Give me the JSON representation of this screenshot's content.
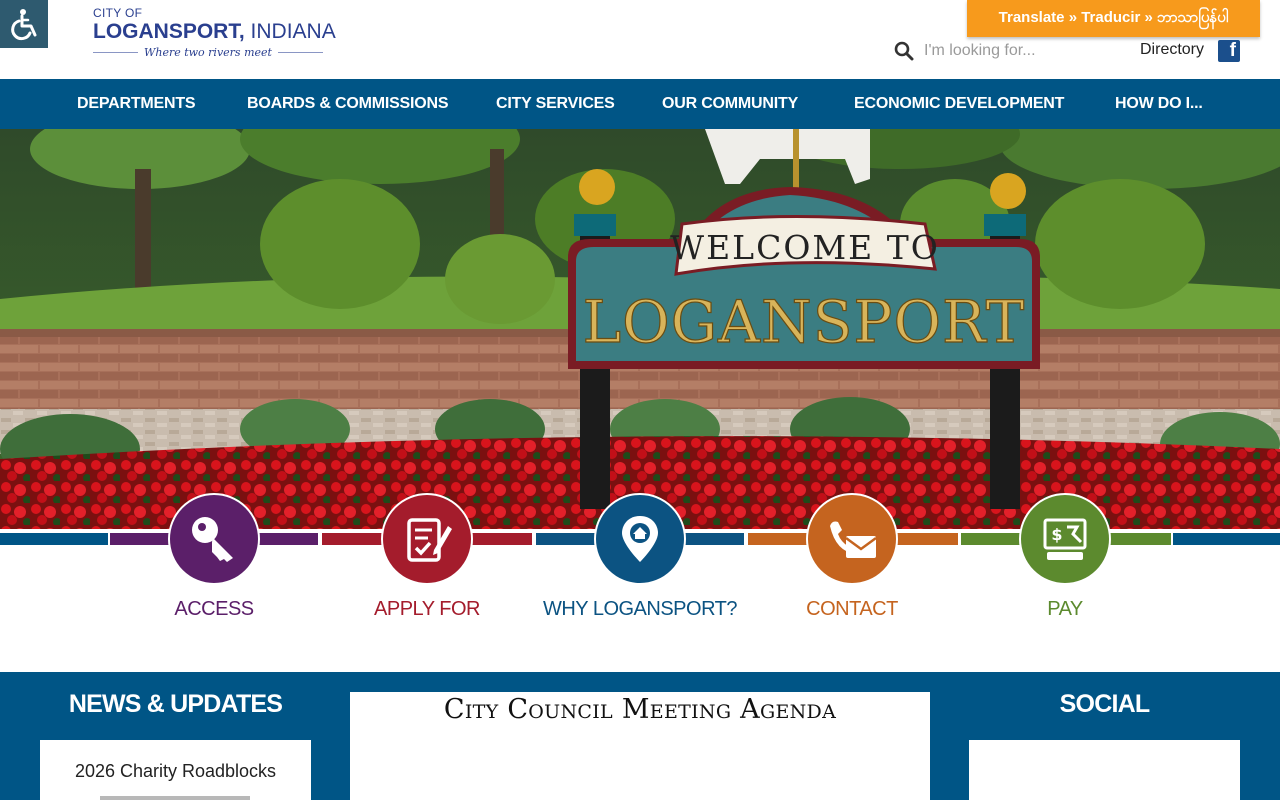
{
  "header": {
    "logo_small": "CITY OF",
    "logo_city": "LOGANSPORT,",
    "logo_state": "INDIANA",
    "logo_tagline": "Where two rivers meet",
    "translate_label": "Translate » Traducir » ဘာသာပြန်ပါ",
    "search_placeholder": "I'm looking for...",
    "directory_label": "Directory",
    "facebook_glyph": "f"
  },
  "nav": {
    "items": [
      {
        "label": "DEPARTMENTS"
      },
      {
        "label": "BOARDS & COMMISSIONS"
      },
      {
        "label": "CITY SERVICES"
      },
      {
        "label": "OUR COMMUNITY"
      },
      {
        "label": "ECONOMIC DEVELOPMENT"
      },
      {
        "label": "HOW DO I..."
      }
    ]
  },
  "hero": {
    "sign_top": "WELCOME TO",
    "sign_main": "LOGANSPORT"
  },
  "quick_links": [
    {
      "label": "ACCESS",
      "icon": "key-icon",
      "color": "#5b1f69"
    },
    {
      "label": "APPLY FOR",
      "icon": "form-icon",
      "color": "#a41c2c"
    },
    {
      "label": "WHY LOGANSPORT?",
      "icon": "map-pin-home-icon",
      "color": "#0c5382"
    },
    {
      "label": "CONTACT",
      "icon": "phone-envelope-icon",
      "color": "#c5641f"
    },
    {
      "label": "PAY",
      "icon": "payment-icon",
      "color": "#5c8a2e"
    }
  ],
  "sections": {
    "news_title": "NEWS & UPDATES",
    "news_item": "2026 Charity Roadblocks",
    "agenda_title": "City Council Meeting Agenda",
    "social_title": "SOCIAL"
  },
  "colors": {
    "nav_blue": "#005586",
    "translate_orange": "#f79a1c",
    "logo_navy": "#2a3f8f"
  }
}
